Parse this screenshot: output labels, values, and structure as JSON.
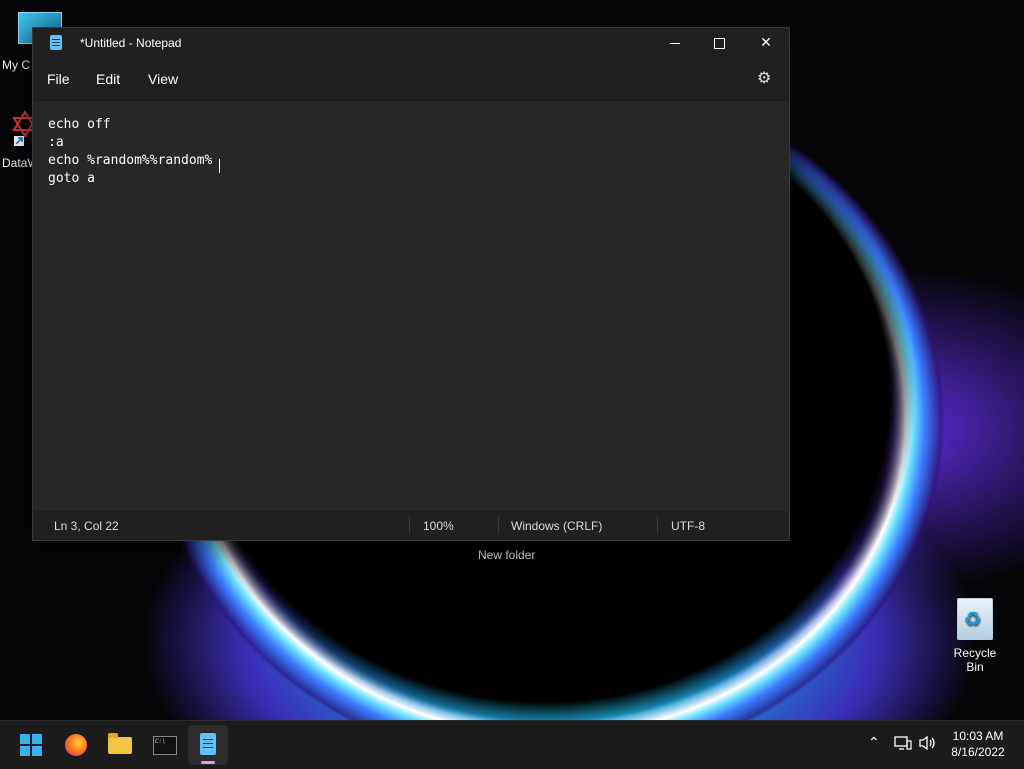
{
  "desktop": {
    "icons": [
      {
        "label": "My C"
      },
      {
        "label": "DataW"
      },
      {
        "label": "Recycle Bin"
      }
    ],
    "new_folder_label": "New folder"
  },
  "window": {
    "title": "*Untitled - Notepad",
    "menu": [
      "File",
      "Edit",
      "View"
    ],
    "settings_icon": "gear-icon",
    "content_lines": [
      "echo off",
      ":a",
      "echo %random%%random%",
      "goto a"
    ],
    "status": {
      "position": "Ln 3, Col 22",
      "zoom": "100%",
      "line_ending": "Windows (CRLF)",
      "encoding": "UTF-8"
    }
  },
  "taskbar": {
    "apps": [
      "start-icon",
      "firefox-icon",
      "file-explorer-icon",
      "terminal-icon",
      "notepad-icon"
    ],
    "active_app": "notepad",
    "time": "10:03 AM",
    "date": "8/16/2022"
  },
  "colors": {
    "window_bg": "#272727",
    "titlebar_bg": "#202020",
    "taskbar_bg": "#1c1c1c",
    "accent": "#5ec3f2"
  }
}
